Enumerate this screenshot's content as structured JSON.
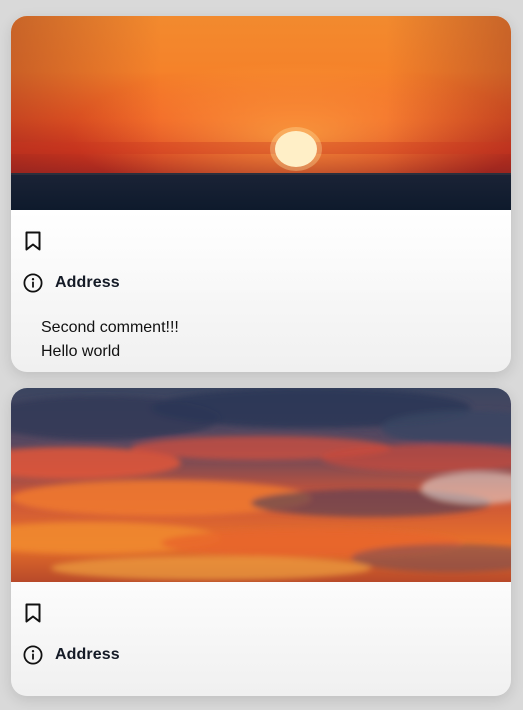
{
  "posts": [
    {
      "image": {
        "alt": "",
        "scene": "sunset-over-sea"
      },
      "bookmark_icon": "bookmark-icon",
      "info_icon": "info-icon",
      "address_label": "Address",
      "comments": [
        "Second comment!!!",
        "Hello world"
      ]
    },
    {
      "image": {
        "alt": "",
        "scene": "fiery-sunset-clouds"
      },
      "bookmark_icon": "bookmark-icon",
      "info_icon": "info-icon",
      "address_label": "Address",
      "comments": []
    }
  ],
  "colors": {
    "page_background": "#d9d9d9",
    "card_background": "#ffffff",
    "text_primary": "#141a26",
    "icon_stroke": "#111111"
  }
}
